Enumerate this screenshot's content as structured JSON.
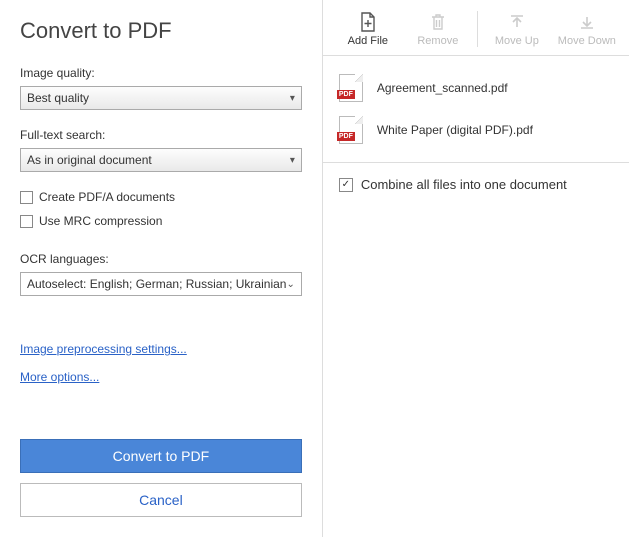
{
  "title": "Convert to PDF",
  "fields": {
    "imageQuality": {
      "label": "Image quality:",
      "value": "Best quality"
    },
    "fullTextSearch": {
      "label": "Full-text search:",
      "value": "As in original document"
    },
    "createPdfA": {
      "label": "Create PDF/A documents",
      "checked": false
    },
    "useMrc": {
      "label": "Use MRC compression",
      "checked": false
    },
    "ocrLanguages": {
      "label": "OCR languages:",
      "value": "Autoselect: English; German; Russian; Ukrainian"
    }
  },
  "links": {
    "preprocessing": "Image preprocessing settings...",
    "moreOptions": "More options..."
  },
  "buttons": {
    "convert": "Convert to PDF",
    "cancel": "Cancel"
  },
  "toolbar": {
    "addFile": "Add File",
    "remove": "Remove",
    "moveUp": "Move Up",
    "moveDown": "Move Down"
  },
  "files": [
    {
      "name": "Agreement_scanned.pdf",
      "badge": "PDF"
    },
    {
      "name": "White Paper (digital PDF).pdf",
      "badge": "PDF"
    }
  ],
  "combine": {
    "label": "Combine all files into one document",
    "checked": true
  }
}
